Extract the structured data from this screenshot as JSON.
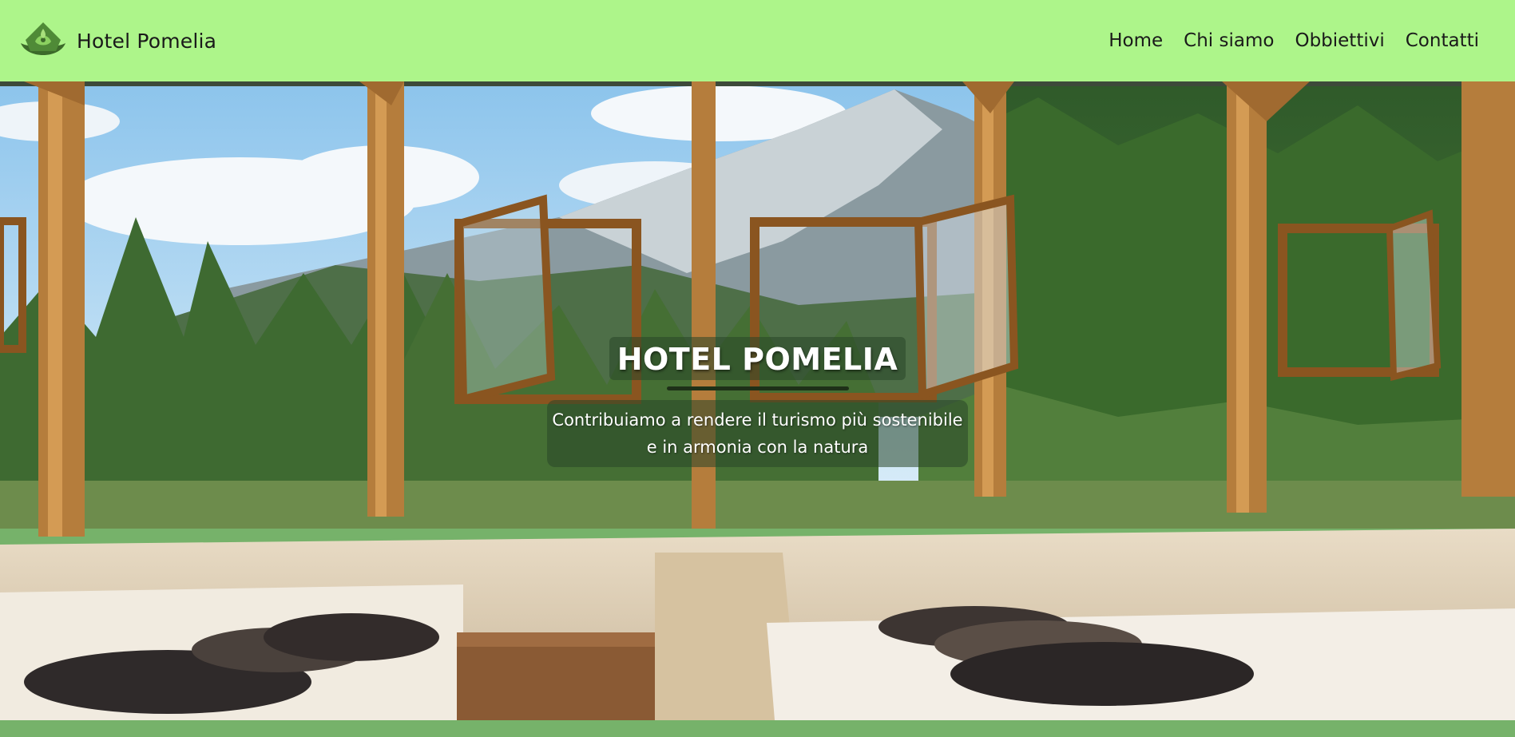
{
  "header": {
    "brand_name": "Hotel Pomelia",
    "logo_icon": "lotus-leaf-icon",
    "nav": [
      {
        "label": "Home"
      },
      {
        "label": "Chi siamo"
      },
      {
        "label": "Obbiettivi"
      },
      {
        "label": "Contatti"
      }
    ]
  },
  "hero": {
    "title": "HOTEL POMELIA",
    "subtitle_line1": "Contribuiamo a rendere il turismo più sostenibile",
    "subtitle_line2": "e in armonia con la natura",
    "image_description": "glass room with wooden frames overlooking forest and mountains"
  },
  "colors": {
    "nav_background": "#adf58a",
    "footer_strip": "#76b26a",
    "text": "#1a1a1a"
  }
}
